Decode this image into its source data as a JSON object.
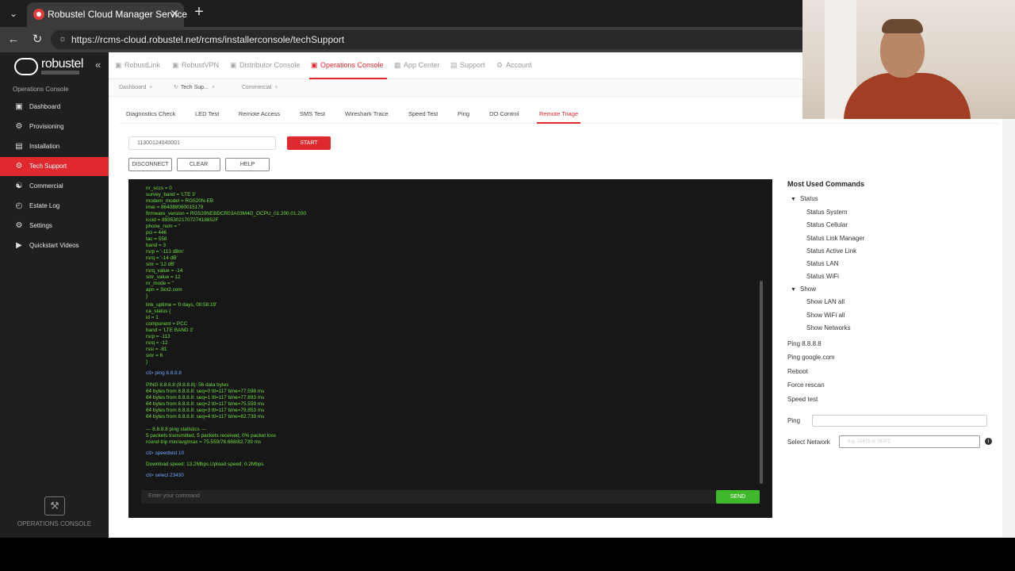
{
  "browser": {
    "tab_title": "Robustel Cloud Manager Service",
    "url": "https://rcms-cloud.robustel.net/rcms/installerconsole/techSupport"
  },
  "sidebar": {
    "brand": "robustel",
    "section_label": "Operations Console",
    "items": [
      {
        "label": "Dashboard",
        "icon": "dashboard-icon"
      },
      {
        "label": "Provisioning",
        "icon": "provisioning-icon"
      },
      {
        "label": "Installation",
        "icon": "installation-icon"
      },
      {
        "label": "Tech Support",
        "icon": "tech-support-icon"
      },
      {
        "label": "Commercial",
        "icon": "commercial-icon"
      },
      {
        "label": "Estate Log",
        "icon": "estate-log-icon"
      },
      {
        "label": "Settings",
        "icon": "settings-icon"
      },
      {
        "label": "Quickstart Videos",
        "icon": "video-icon"
      }
    ],
    "footer_label": "OPERATIONS CONSOLE"
  },
  "topnav": {
    "items": [
      "RobustLink",
      "RobustVPN",
      "Distributor Console",
      "Operations Console",
      "App Center",
      "Support",
      "Account"
    ]
  },
  "page_tabs": [
    "Dashboard",
    "Tech Sup...",
    "Commercial"
  ],
  "sub_tabs": [
    "Diagnostics Check",
    "LED Test",
    "Remote Access",
    "SMS Test",
    "Wireshark Trace",
    "Speed Test",
    "Ping",
    "DO Control",
    "Remote Triage"
  ],
  "controls": {
    "serial_value": "11300124040001",
    "start_label": "START",
    "disconnect_label": "DISCONNECT",
    "clear_label": "CLEAR",
    "help_label": "HELP"
  },
  "terminal": {
    "lines": [
      {
        "text": "nr_sccs = 0",
        "cmd": false
      },
      {
        "text": "survey_band = 'LTE 3'",
        "cmd": false
      },
      {
        "text": "modem_model = RG520N-EB",
        "cmd": false
      },
      {
        "text": "imei = 864088060015179",
        "cmd": false
      },
      {
        "text": "firmware_version = RG520NEBDCR03A03M4G_OCPU_01.200.01.200",
        "cmd": false
      },
      {
        "text": "iccid = 8935302170727418852F",
        "cmd": false
      },
      {
        "text": "phone_num = ''",
        "cmd": false
      },
      {
        "text": "pci = 446",
        "cmd": false
      },
      {
        "text": "tac = 558",
        "cmd": false
      },
      {
        "text": "band = 3",
        "cmd": false
      },
      {
        "text": "rsrp = '-113 dBm'",
        "cmd": false
      },
      {
        "text": "rsrq = '-14 dB'",
        "cmd": false
      },
      {
        "text": "sinr = '12 dB'",
        "cmd": false
      },
      {
        "text": "rsrq_value = -14",
        "cmd": false
      },
      {
        "text": "sinr_value = 12",
        "cmd": false
      },
      {
        "text": "nr_mode = ''",
        "cmd": false
      },
      {
        "text": "apn = 3iot2.com",
        "cmd": false
      },
      {
        "text": "}",
        "cmd": false
      },
      {
        "text": "link_uptime = '0 days, 00:58:19'",
        "cmd": false
      },
      {
        "text": "ca_status {",
        "cmd": false
      },
      {
        "text": "id = 1",
        "cmd": false
      },
      {
        "text": "component = PCC",
        "cmd": false
      },
      {
        "text": "band = 'LTE BAND 3'",
        "cmd": false
      },
      {
        "text": "rsrp = -113",
        "cmd": false
      },
      {
        "text": "rsrq = -12",
        "cmd": false
      },
      {
        "text": "rssi = -81",
        "cmd": false
      },
      {
        "text": "sinr = 6",
        "cmd": false
      },
      {
        "text": "}",
        "cmd": false
      },
      {
        "text": "cli> ping 8.8.8.8",
        "cmd": true
      },
      {
        "text": "PING 8.8.8.8 (8.8.8.8): 56 data bytes",
        "cmd": false
      },
      {
        "text": "64 bytes from 8.8.8.8: seq=0 ttl=117 time=77.598 ms",
        "cmd": false
      },
      {
        "text": "64 bytes from 8.8.8.8: seq=1 ttl=117 time=77.893 ms",
        "cmd": false
      },
      {
        "text": "64 bytes from 8.8.8.8: seq=2 ttl=117 time=75.559 ms",
        "cmd": false
      },
      {
        "text": "64 bytes from 8.8.8.8: seq=3 ttl=117 time=79.853 ms",
        "cmd": false
      },
      {
        "text": "64 bytes from 8.8.8.8: seq=4 ttl=117 time=82.739 ms",
        "cmd": false
      },
      {
        "text": "--- 8.8.8.8 ping statistics ---",
        "cmd": false
      },
      {
        "text": "5 packets transmitted, 5 packets received, 0% packet loss",
        "cmd": false
      },
      {
        "text": "round-trip min/avg/max = 75.559/78.688/82.739 ms",
        "cmd": false
      },
      {
        "text": "cli> speedtest 10",
        "cmd": true
      },
      {
        "text": "Download speed: 13.2Mbps,Upload speed: 0.2Mbps",
        "cmd": false
      },
      {
        "text": "cli> select 23430",
        "cmd": true
      }
    ],
    "input_placeholder": "Enter your command",
    "send_label": "SEND"
  },
  "commands": {
    "title": "Most Used Commands",
    "status_group": "Status",
    "status_items": [
      "Status System",
      "Status Cellular",
      "Status Link Manager",
      "Status Active Link",
      "Status LAN",
      "Status WiFi"
    ],
    "show_group": "Show",
    "show_items": [
      "Show LAN all",
      "Show WiFi all",
      "Show Networks"
    ],
    "other_items": [
      "Ping 8.8.8.8",
      "Ping google.com",
      "Reboot",
      "Force rescan",
      "Speed test"
    ],
    "ping_label": "Ping",
    "select_network_label": "Select Network",
    "select_network_placeholder": "e.g. 23415 or 26201"
  }
}
